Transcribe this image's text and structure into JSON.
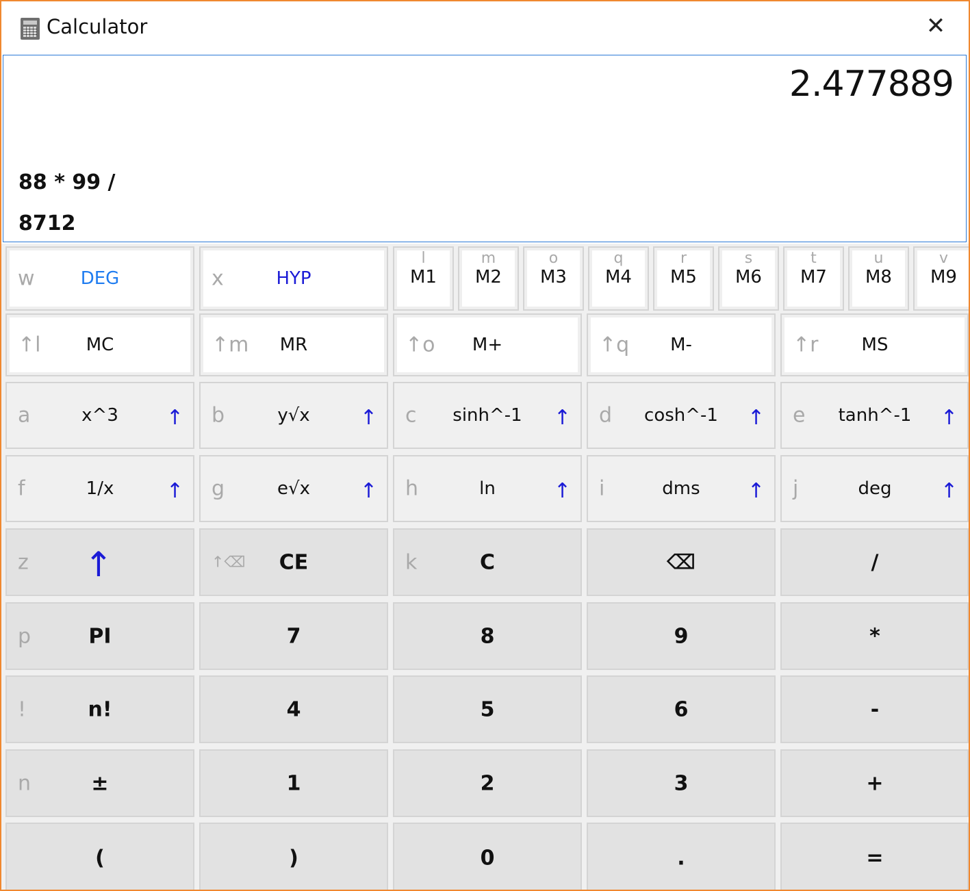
{
  "window": {
    "title": "Calculator",
    "close_glyph": "✕"
  },
  "display": {
    "result": "2.477889",
    "expression_line1": "88 * 99 /",
    "expression_line2": "8712"
  },
  "row1": {
    "deg": {
      "hint": "w",
      "label": "DEG"
    },
    "hyp": {
      "hint": "x",
      "label": "HYP"
    },
    "memory": [
      {
        "hint": "l",
        "label": "M1"
      },
      {
        "hint": "m",
        "label": "M2"
      },
      {
        "hint": "o",
        "label": "M3"
      },
      {
        "hint": "q",
        "label": "M4"
      },
      {
        "hint": "r",
        "label": "M5"
      },
      {
        "hint": "s",
        "label": "M6"
      },
      {
        "hint": "t",
        "label": "M7"
      },
      {
        "hint": "u",
        "label": "M8"
      },
      {
        "hint": "v",
        "label": "M9"
      }
    ]
  },
  "row2": [
    {
      "hint": "↑l",
      "label": "MC"
    },
    {
      "hint": "↑m",
      "label": "MR"
    },
    {
      "hint": "↑o",
      "label": "M+"
    },
    {
      "hint": "↑q",
      "label": "M-"
    },
    {
      "hint": "↑r",
      "label": "MS"
    }
  ],
  "row3": [
    {
      "hint": "a",
      "label": "x^3",
      "arrow": "↑"
    },
    {
      "hint": "b",
      "label": "y√x",
      "arrow": "↑"
    },
    {
      "hint": "c",
      "label": "sinh^-1",
      "arrow": "↑"
    },
    {
      "hint": "d",
      "label": "cosh^-1",
      "arrow": "↑"
    },
    {
      "hint": "e",
      "label": "tanh^-1",
      "arrow": "↑"
    }
  ],
  "row4": [
    {
      "hint": "f",
      "label": "1/x",
      "arrow": "↑"
    },
    {
      "hint": "g",
      "label": "e√x",
      "arrow": "↑"
    },
    {
      "hint": "h",
      "label": "ln",
      "arrow": "↑"
    },
    {
      "hint": "i",
      "label": "dms",
      "arrow": "↑"
    },
    {
      "hint": "j",
      "label": "deg",
      "arrow": "↑"
    }
  ],
  "row5": [
    {
      "hint": "z",
      "label": "↑"
    },
    {
      "hint": "↑⌫",
      "label": "CE"
    },
    {
      "hint": "k",
      "label": "C"
    },
    {
      "hint": "",
      "label": "⌫"
    },
    {
      "hint": "",
      "label": "/"
    }
  ],
  "row6": [
    {
      "hint": "p",
      "label": "PI"
    },
    {
      "hint": "",
      "label": "7"
    },
    {
      "hint": "",
      "label": "8"
    },
    {
      "hint": "",
      "label": "9"
    },
    {
      "hint": "",
      "label": "*"
    }
  ],
  "row7": [
    {
      "hint": "!",
      "label": "n!"
    },
    {
      "hint": "",
      "label": "4"
    },
    {
      "hint": "",
      "label": "5"
    },
    {
      "hint": "",
      "label": "6"
    },
    {
      "hint": "",
      "label": "-"
    }
  ],
  "row8": [
    {
      "hint": "n",
      "label": "±"
    },
    {
      "hint": "",
      "label": "1"
    },
    {
      "hint": "",
      "label": "2"
    },
    {
      "hint": "",
      "label": "3"
    },
    {
      "hint": "",
      "label": "+"
    }
  ],
  "row9": [
    {
      "hint": "",
      "label": "("
    },
    {
      "hint": "",
      "label": ")"
    },
    {
      "hint": "",
      "label": "0"
    },
    {
      "hint": "",
      "label": "."
    },
    {
      "hint": "",
      "label": "="
    }
  ]
}
